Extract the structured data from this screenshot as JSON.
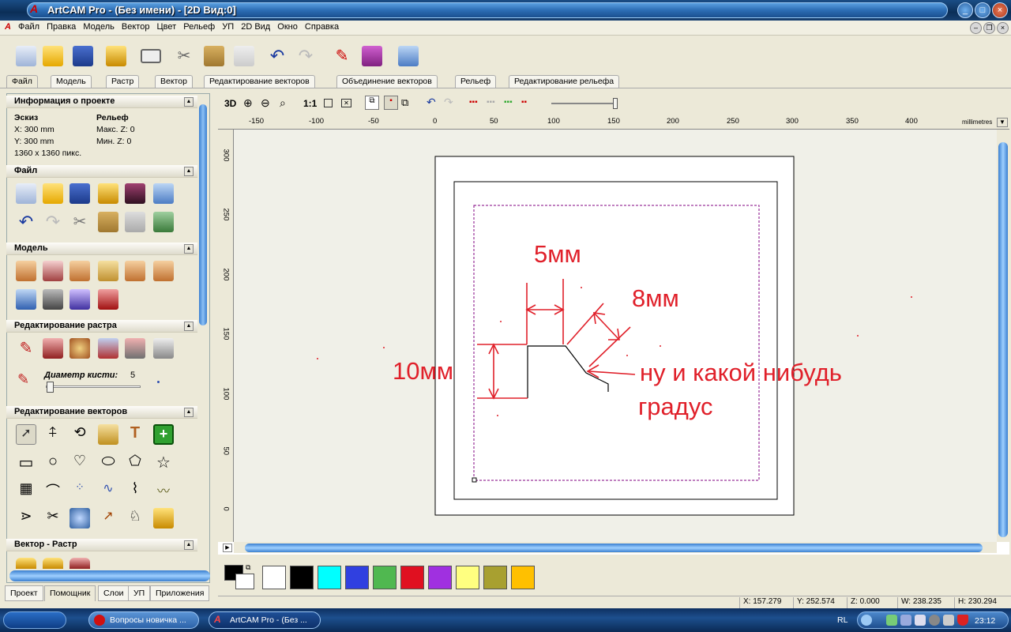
{
  "window": {
    "title": "ArtCAM Pro - (Без имени) - [2D Вид:0]",
    "app_icon_letter": "A",
    "buttons": [
      "minimize",
      "maximize",
      "close"
    ]
  },
  "menu": [
    "Файл",
    "Правка",
    "Модель",
    "Вектор",
    "Цвет",
    "Рельеф",
    "УП",
    "2D Вид",
    "Окно",
    "Справка"
  ],
  "main_tabs": [
    "Файл",
    "Модель",
    "Растр",
    "Вектор",
    "Редактирование векторов",
    "Объединение векторов",
    "Рельеф",
    "Редактирование рельефа"
  ],
  "panel": {
    "project_info": {
      "title": "Информация о проекте",
      "sketch_label": "Эскиз",
      "relief_label": "Рельеф",
      "x": "X: 300 mm",
      "y": "Y: 300 mm",
      "pixels": "1360 x 1360 пикс.",
      "max_z": "Макс. Z: 0",
      "min_z": "Мин. Z: 0"
    },
    "file_title": "Файл",
    "model_title": "Модель",
    "raster_edit_title": "Редактирование растра",
    "brush_label": "Диаметр кисти:",
    "brush_value": "5",
    "vector_edit_title": "Редактирование векторов",
    "vector_raster_title": "Вектор - Растр"
  },
  "bottom_tabs": [
    "Проект",
    "Помощник",
    "Слои",
    "УП",
    "Приложения"
  ],
  "view_toolbar": {
    "btn_3d": "3D",
    "btn_1to1": "1:1"
  },
  "ruler": {
    "top_labels": [
      "-150",
      "-100",
      "-50",
      "0",
      "50",
      "100",
      "150",
      "200",
      "250",
      "300",
      "350",
      "400"
    ],
    "units": "millimetres",
    "left_labels": [
      "300",
      "250",
      "200",
      "150",
      "100",
      "50",
      "0"
    ]
  },
  "annotations": {
    "dim_5mm": "5мм",
    "dim_8mm": "8мм",
    "dim_10mm": "10мм",
    "note_line1": "ну и какой нибудь",
    "note_line2": "градус",
    "color": "#e0202a"
  },
  "palette": {
    "colors": [
      "#ffffff",
      "#000000",
      "#00ffff",
      "#3040e0",
      "#50b850",
      "#e01020",
      "#a030e0",
      "#ffff80",
      "#a8a030",
      "#ffc000"
    ]
  },
  "status": {
    "x": "X: 157.279",
    "y": "Y: 252.574",
    "z": "Z: 0.000",
    "w": "W: 238.235",
    "h": "H: 230.294"
  },
  "taskbar": {
    "items": [
      "Вопросы новичка ...",
      "ArtCAM Pro - (Без ..."
    ],
    "lang": "RL",
    "time": "23:12"
  }
}
